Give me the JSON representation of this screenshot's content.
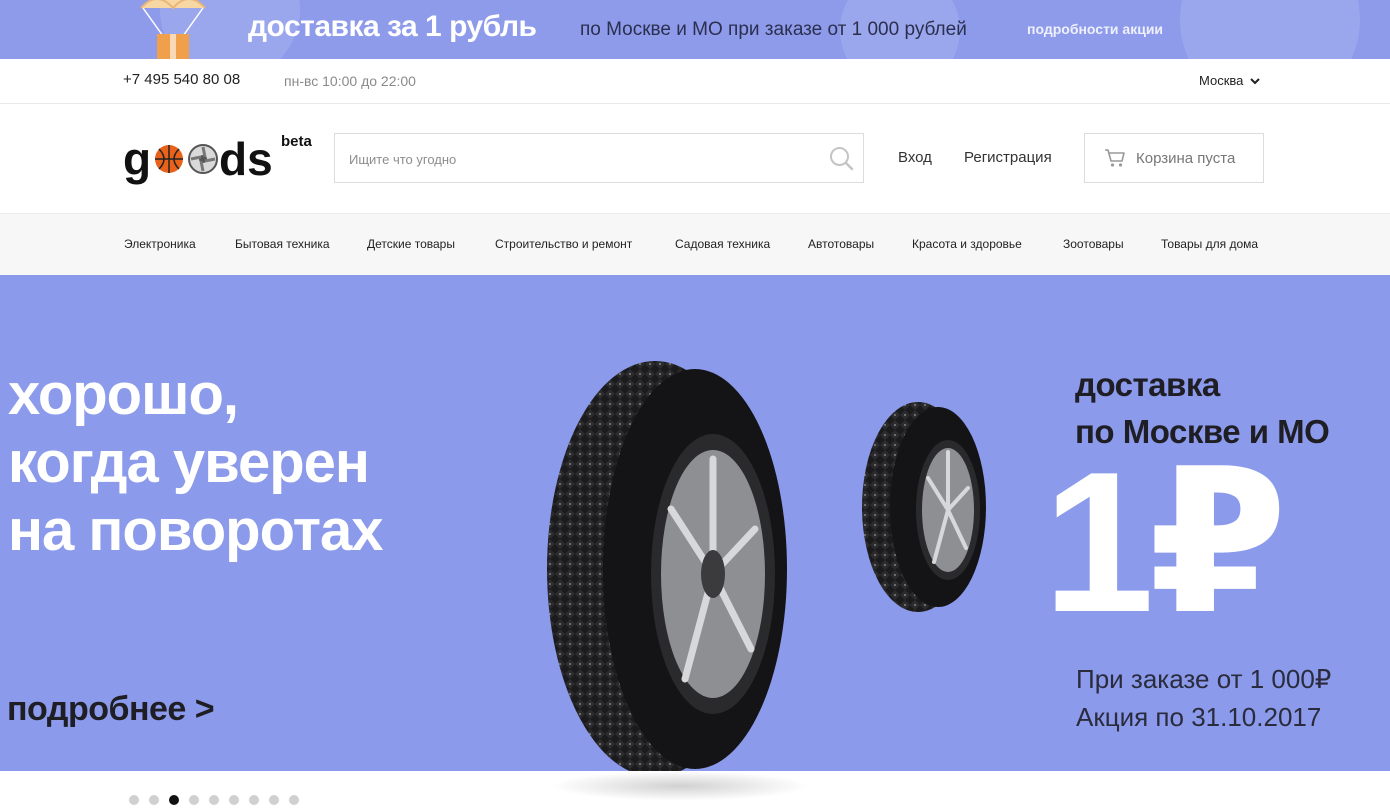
{
  "promo": {
    "title": "доставка за 1 рубль",
    "subtitle": "по Москве и МО при заказе от 1 000 рублей",
    "link": "подробности акции",
    "background": "#8e9bea"
  },
  "info_bar": {
    "phone": "+7 495 540 80 08",
    "hours": "пн-вс 10:00 до 22:00",
    "city": "Москва"
  },
  "header": {
    "logo_text": "goods",
    "logo_badge": "beta",
    "search_placeholder": "Ищите что угодно",
    "search_value": "",
    "login": "Вход",
    "register": "Регистрация",
    "cart_label": "Корзина пуста"
  },
  "nav": {
    "items": [
      "Электроника",
      "Бытовая техника",
      "Детские товары",
      "Строительство и ремонт",
      "Садовая техника",
      "Автотовары",
      "Красота и здоровье",
      "Зоотовары",
      "Товары для дома"
    ]
  },
  "hero": {
    "headline": [
      "хорошо,",
      "когда уверен",
      "на поворотах"
    ],
    "more_link": "подробнее >",
    "delivery_lines": [
      "доставка",
      "по Москве и МО"
    ],
    "price": "1₽",
    "conditions": [
      "При заказе от 1 000₽",
      "Акция по 31.10.2017"
    ],
    "background": "#8b9aea"
  },
  "carousel": {
    "total_slides": 9,
    "active_slide": 3
  }
}
